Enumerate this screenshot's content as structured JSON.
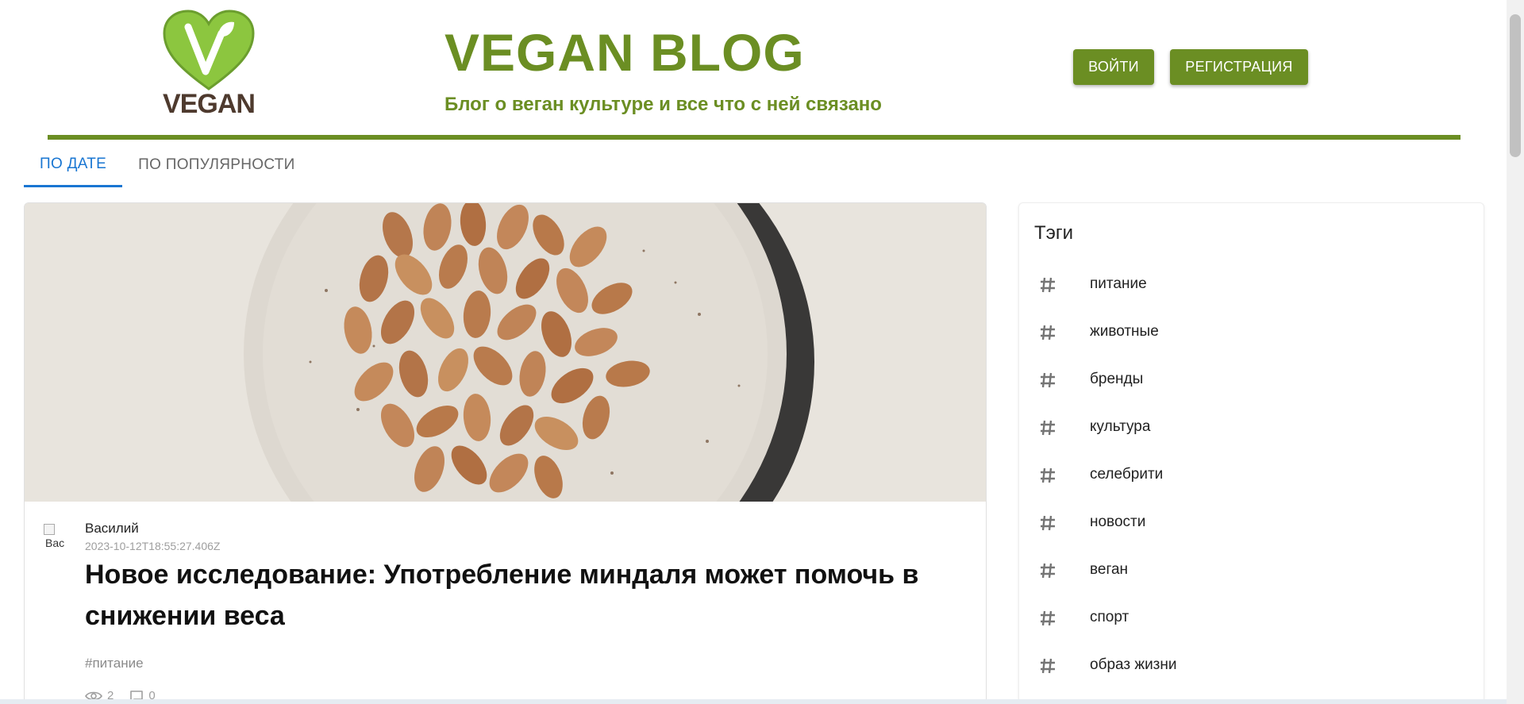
{
  "header": {
    "logo_text": "VEGAN",
    "title": "VEGAN BLOG",
    "subtitle": "Блог о веган культуре и все что с ней связано",
    "login_label": "ВОЙТИ",
    "register_label": "РЕГИСТРАЦИЯ"
  },
  "tabs": [
    {
      "label": "ПО ДАТЕ",
      "active": true
    },
    {
      "label": "ПО ПОПУЛЯРНОСТИ",
      "active": false
    }
  ],
  "post": {
    "avatar_alt": "Вас",
    "author": "Василий",
    "date": "2023-10-12T18:55:27.406Z",
    "title": "Новое исследование: Употребление миндаля может помочь в снижении веса",
    "tag": "#питание",
    "views": "2",
    "comments": "0"
  },
  "tags_panel": {
    "title": "Тэги",
    "items": [
      "питание",
      "животные",
      "бренды",
      "культура",
      "селебрити",
      "новости",
      "веган",
      "спорт",
      "образ жизни"
    ]
  },
  "colors": {
    "brand_green": "#6b8e23",
    "tab_active_blue": "#1976d2"
  },
  "icons": {
    "tag": "hash-icon",
    "views": "eye-icon",
    "comments": "comment-icon"
  }
}
